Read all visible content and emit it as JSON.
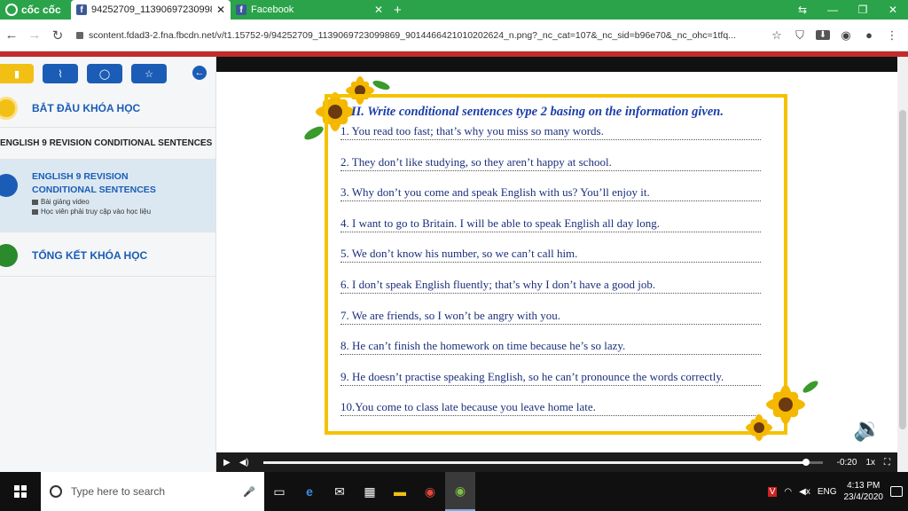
{
  "browser": {
    "brand": "cốc cốc",
    "tabs": [
      {
        "title": "94252709_113906972309986",
        "close": "✕"
      },
      {
        "title": "Facebook",
        "close": "✕"
      }
    ],
    "new_tab": "+",
    "window_controls": {
      "minimize": "—",
      "restore": "❐",
      "close": "✕"
    },
    "url": "scontent.fdad3-2.fna.fbcdn.net/v/t1.15752-9/94252709_1139069723099869_9014466421010202624_n.png?_nc_cat=107&_nc_sid=b96e70&_nc_ohc=1tfq..."
  },
  "sidebar": {
    "tab_icons": [
      "book-icon",
      "paperclip-icon",
      "chat-icon",
      "star-icon"
    ],
    "collapse_icon": "arrow-left-icon",
    "start_label": "BẮT ĐẦU KHÓA HỌC",
    "section_title": "ENGLISH 9 REVISION CONDITIONAL SENTENCES",
    "active_lesson": {
      "title": "ENGLISH 9 REVISION CONDITIONAL SENTENCES",
      "type": "Bài giảng video",
      "note": "Học viên phải truy cập vào học liệu"
    },
    "end_label": "TỔNG KẾT KHÓA HỌC"
  },
  "worksheet": {
    "title": "II. Write conditional sentences type 2 basing on the information given.",
    "items": [
      "1.    You read too fast; that’s why you miss so many words.",
      "2. They don’t like studying, so they aren’t happy at school.",
      "3. Why don’t you come and speak English with us? You’ll enjoy it.",
      "4. I want to go to Britain. I will be able to speak English all day long.",
      "5. We don’t know his number, so we can’t call him.",
      "6. I don’t speak English fluently; that’s why I don’t have a good job.",
      "7. We are friends, so I won’t be angry with you.",
      "8. He can’t finish the homework on time because he’s so lazy.",
      "9. He doesn’t practise speaking English, so he can’t pronounce the words correctly.",
      "10.You come to class late because you leave home late."
    ]
  },
  "player": {
    "time_remaining": "-0:20",
    "speed": "1x",
    "progress": 0.97
  },
  "taskbar": {
    "search_placeholder": "Type here to search",
    "language": "ENG",
    "time": "4:13 PM",
    "date": "23/4/2020"
  },
  "colors": {
    "accent_blue": "#1b5db6",
    "browser_green": "#2aa34a",
    "worksheet_border": "#f5c200",
    "worksheet_text": "#1b2f7a"
  }
}
